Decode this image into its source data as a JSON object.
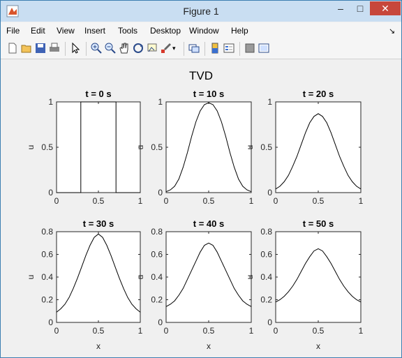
{
  "window": {
    "title": "Figure 1"
  },
  "menu": [
    "File",
    "Edit",
    "View",
    "Insert",
    "Tools",
    "Desktop",
    "Window",
    "Help"
  ],
  "toolbar_icons": [
    "new-figure-icon",
    "open-file-icon",
    "save-icon",
    "print-icon",
    "pointer-icon",
    "zoom-in-icon",
    "zoom-out-icon",
    "pan-hand-icon",
    "rotate-3d-icon",
    "data-cursor-icon",
    "brush-icon",
    "link-plot-icon",
    "colorbar-icon",
    "legend-icon",
    "hide-plot-tools-icon",
    "show-plot-tools-icon"
  ],
  "figure": {
    "suptitle": "TVD"
  },
  "chart_data": [
    {
      "type": "line",
      "title": "t = 0 s",
      "xlabel": "",
      "ylabel": "u",
      "xlim": [
        0,
        1
      ],
      "ylim": [
        0,
        1
      ],
      "xticks": [
        "0",
        "0.5",
        "1"
      ],
      "yticks": [
        "0",
        "0.5",
        "1"
      ],
      "x": [
        0,
        0.29,
        0.29,
        0.71,
        0.71,
        1
      ],
      "y": [
        0,
        0,
        1,
        1,
        0,
        0
      ]
    },
    {
      "type": "line",
      "title": "t = 10 s",
      "xlabel": "",
      "ylabel": "u",
      "xlim": [
        0,
        1
      ],
      "ylim": [
        0,
        1
      ],
      "xticks": [
        "0",
        "0.5",
        "1"
      ],
      "yticks": [
        "0",
        "0.5",
        "1"
      ],
      "x": [
        0,
        0.05,
        0.1,
        0.15,
        0.2,
        0.25,
        0.3,
        0.35,
        0.4,
        0.45,
        0.5,
        0.55,
        0.6,
        0.65,
        0.7,
        0.75,
        0.8,
        0.85,
        0.9,
        0.95,
        1
      ],
      "y": [
        0.01,
        0.03,
        0.07,
        0.15,
        0.28,
        0.44,
        0.62,
        0.78,
        0.9,
        0.97,
        0.99,
        0.97,
        0.9,
        0.78,
        0.62,
        0.44,
        0.28,
        0.15,
        0.07,
        0.03,
        0.01
      ]
    },
    {
      "type": "line",
      "title": "t = 20 s",
      "xlabel": "",
      "ylabel": "u",
      "xlim": [
        0,
        1
      ],
      "ylim": [
        0,
        1
      ],
      "xticks": [
        "0",
        "0.5",
        "1"
      ],
      "yticks": [
        "0",
        "0.5",
        "1"
      ],
      "x": [
        0,
        0.05,
        0.1,
        0.15,
        0.2,
        0.25,
        0.3,
        0.35,
        0.4,
        0.45,
        0.5,
        0.55,
        0.6,
        0.65,
        0.7,
        0.75,
        0.8,
        0.85,
        0.9,
        0.95,
        1
      ],
      "y": [
        0.04,
        0.07,
        0.12,
        0.19,
        0.29,
        0.4,
        0.53,
        0.66,
        0.77,
        0.84,
        0.87,
        0.84,
        0.77,
        0.66,
        0.53,
        0.4,
        0.29,
        0.19,
        0.12,
        0.07,
        0.04
      ]
    },
    {
      "type": "line",
      "title": "t = 30 s",
      "xlabel": "x",
      "ylabel": "u",
      "xlim": [
        0,
        1
      ],
      "ylim": [
        0,
        0.8
      ],
      "xticks": [
        "0",
        "0.5",
        "1"
      ],
      "yticks": [
        "0",
        "0.2",
        "0.4",
        "0.6",
        "0.8"
      ],
      "x": [
        0,
        0.05,
        0.1,
        0.15,
        0.2,
        0.25,
        0.3,
        0.35,
        0.4,
        0.45,
        0.5,
        0.55,
        0.6,
        0.65,
        0.7,
        0.75,
        0.8,
        0.85,
        0.9,
        0.95,
        1
      ],
      "y": [
        0.09,
        0.12,
        0.16,
        0.22,
        0.3,
        0.39,
        0.49,
        0.59,
        0.68,
        0.75,
        0.78,
        0.75,
        0.68,
        0.59,
        0.49,
        0.39,
        0.3,
        0.22,
        0.16,
        0.12,
        0.09
      ]
    },
    {
      "type": "line",
      "title": "t = 40 s",
      "xlabel": "x",
      "ylabel": "u",
      "xlim": [
        0,
        1
      ],
      "ylim": [
        0,
        0.8
      ],
      "xticks": [
        "0",
        "0.5",
        "1"
      ],
      "yticks": [
        "0",
        "0.2",
        "0.4",
        "0.6",
        "0.8"
      ],
      "x": [
        0,
        0.05,
        0.1,
        0.15,
        0.2,
        0.25,
        0.3,
        0.35,
        0.4,
        0.45,
        0.5,
        0.55,
        0.6,
        0.65,
        0.7,
        0.75,
        0.8,
        0.85,
        0.9,
        0.95,
        1
      ],
      "y": [
        0.14,
        0.16,
        0.19,
        0.24,
        0.3,
        0.38,
        0.46,
        0.54,
        0.62,
        0.68,
        0.7,
        0.68,
        0.62,
        0.54,
        0.46,
        0.38,
        0.3,
        0.24,
        0.19,
        0.16,
        0.14
      ]
    },
    {
      "type": "line",
      "title": "t = 50 s",
      "xlabel": "x",
      "ylabel": "u",
      "xlim": [
        0,
        1
      ],
      "ylim": [
        0,
        0.8
      ],
      "xticks": [
        "0",
        "0.5",
        "1"
      ],
      "yticks": [
        "0",
        "0.2",
        "0.4",
        "0.6",
        "0.8"
      ],
      "x": [
        0,
        0.05,
        0.1,
        0.15,
        0.2,
        0.25,
        0.3,
        0.35,
        0.4,
        0.45,
        0.5,
        0.55,
        0.6,
        0.65,
        0.7,
        0.75,
        0.8,
        0.85,
        0.9,
        0.95,
        1
      ],
      "y": [
        0.18,
        0.2,
        0.23,
        0.27,
        0.32,
        0.38,
        0.45,
        0.52,
        0.58,
        0.63,
        0.65,
        0.63,
        0.58,
        0.52,
        0.45,
        0.38,
        0.32,
        0.27,
        0.23,
        0.2,
        0.18
      ]
    }
  ]
}
